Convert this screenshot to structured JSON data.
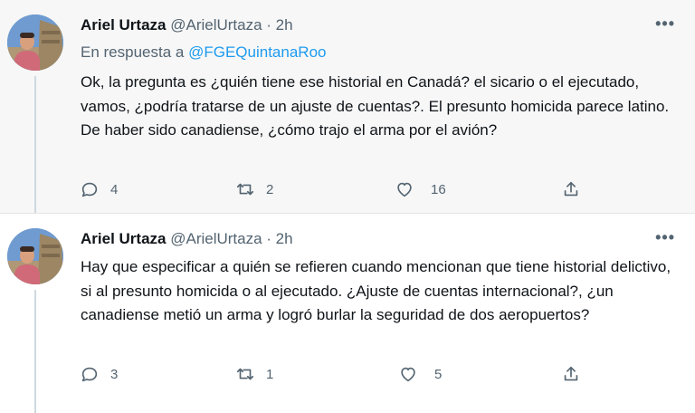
{
  "tweets": [
    {
      "author_name": "Ariel Urtaza",
      "handle": "@ArielUrtaza",
      "time": "2h",
      "reply_prefix": "En respuesta a",
      "reply_mention": "@FGEQuintanaRoo",
      "text": "Ok, la pregunta es ¿quién tiene ese historial en Canadá? el sicario o el ejecutado, vamos, ¿podría tratarse de un ajuste de cuentas?. El presunto homicida parece latino. De haber sido canadiense, ¿cómo trajo el arma por el avión?",
      "replies": "4",
      "retweets": "2",
      "likes": "16"
    },
    {
      "author_name": "Ariel Urtaza",
      "handle": "@ArielUrtaza",
      "time": "2h",
      "text": "Hay que especificar a quién se refieren cuando mencionan que tiene historial delictivo, si al presunto homicida o al ejecutado. ¿Ajuste de cuentas internacional?, ¿un canadiense metió un arma y logró burlar la seguridad de dos aeropuertos?",
      "replies": "3",
      "retweets": "1",
      "likes": "5"
    }
  ],
  "icons": {
    "more": "more-options-icon",
    "reply": "reply-icon",
    "retweet": "retweet-icon",
    "like": "heart-icon",
    "share": "share-icon"
  },
  "colors": {
    "link": "#1d9bf0",
    "muted": "#536471",
    "text": "#0f1419",
    "thread_line": "#cfd9de"
  }
}
